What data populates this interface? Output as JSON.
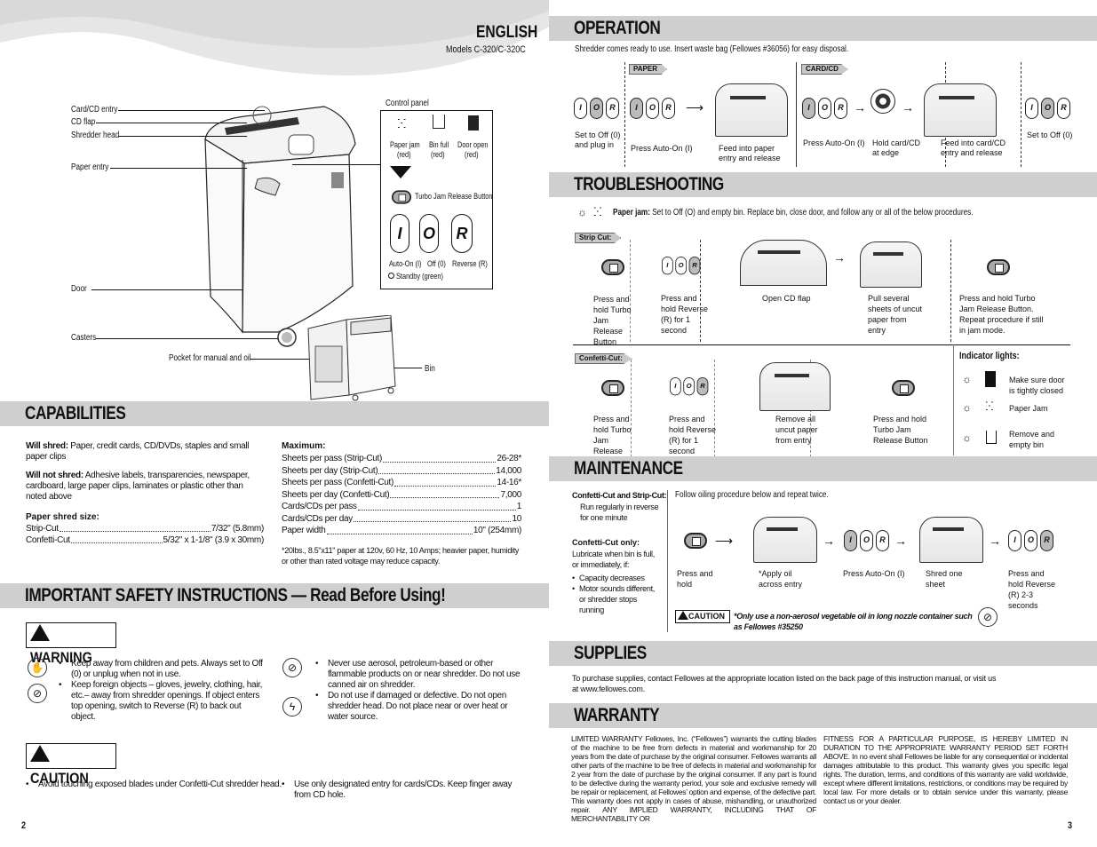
{
  "left_page": {
    "language": "ENGLISH",
    "models": "Models C-320/C-320C",
    "diagram_labels": {
      "card_cd_entry": "Card/CD entry",
      "cd_flap": "CD flap",
      "shredder_head": "Shredder head",
      "paper_entry": "Paper entry",
      "door": "Door",
      "casters": "Casters",
      "pocket": "Pocket for manual and oil",
      "bin": "Bin"
    },
    "control_panel": {
      "title": "Control panel",
      "indicators": [
        {
          "label": "Paper jam",
          "color": "(red)",
          "icon": "paper-jam-icon"
        },
        {
          "label": "Bin full",
          "color": "(red)",
          "icon": "bin-full-icon"
        },
        {
          "label": "Door open",
          "color": "(red)",
          "icon": "door-open-icon"
        }
      ],
      "turbo_label": "Turbo Jam Release Button",
      "buttons": [
        {
          "glyph": "I",
          "label": "Auto-On (I)"
        },
        {
          "glyph": "O",
          "label": "Off (0)"
        },
        {
          "glyph": "R",
          "label": "Reverse (R)"
        }
      ],
      "standby": "Standby (green)"
    },
    "capabilities": {
      "title": "CAPABILITIES",
      "will_shred_label": "Will shred:",
      "will_shred": "Paper, credit cards, CD/DVDs, staples and small paper clips",
      "will_not_shred_label": "Will not shred:",
      "will_not_shred": "Adhesive labels, transparencies, newspaper, cardboard, large paper clips, laminates or plastic other than noted above",
      "shred_size_label": "Paper shred size:",
      "shred_sizes": [
        {
          "name": "Strip-Cut",
          "value": "7/32\" (5.8mm)"
        },
        {
          "name": "Confetti-Cut",
          "value": "5/32\" x 1-1/8\" (3.9 x 30mm)"
        }
      ],
      "maximum_label": "Maximum:",
      "maximums": [
        {
          "name": "Sheets per pass (Strip-Cut)",
          "value": "26-28*"
        },
        {
          "name": "Sheets per day (Strip-Cut)",
          "value": "14,000"
        },
        {
          "name": "Sheets per pass (Confetti-Cut)",
          "value": "14-16*"
        },
        {
          "name": "Sheets per day (Confetti-Cut)",
          "value": "7,000"
        },
        {
          "name": "Cards/CDs per pass",
          "value": "1"
        },
        {
          "name": "Cards/CDs per day",
          "value": "10"
        },
        {
          "name": "Paper width",
          "value": "10\" (254mm)"
        }
      ],
      "footnote": "*20lbs., 8.5\"x11\" paper at 120v, 60 Hz, 10 Amps; heavier paper, humidity or other than rated voltage may reduce capacity."
    },
    "safety": {
      "title": "IMPORTANT SAFETY INSTRUCTIONS — Read Before Using!",
      "warning_label": "WARNING",
      "warnings_left": [
        "Keep away from children and pets. Always set to Off (0) or unplug when not in use.",
        "Keep foreign objects – gloves, jewelry, clothing, hair, etc.–  away from shredder openings. If object enters top opening, switch to Reverse (R) to back out object."
      ],
      "warnings_right": [
        "Never use aerosol, petroleum-based or other flammable products on or near shredder. Do not use canned air on shredder.",
        "Do not use if damaged or defective. Do not open shredder head. Do not place near or over heat or water source."
      ],
      "caution_label": "CAUTION",
      "cautions": [
        "Avoid touching exposed blades under Confetti-Cut shredder head.",
        "Use only designated entry for cards/CDs. Keep finger away from CD hole."
      ]
    },
    "page_number": "2"
  },
  "right_page": {
    "operation": {
      "title": "OPERATION",
      "intro": "Shredder comes ready to use. Insert waste bag (Fellowes #36056) for easy disposal.",
      "paper_tag": "PAPER",
      "card_tag": "CARD/CD",
      "steps": [
        "Set to Off (0) and plug in",
        "Press Auto-On (I)",
        "Feed into paper entry and release",
        "Press Auto-On (I)",
        "Hold card/CD at edge",
        "Feed into card/CD entry and release",
        "Set to Off (0)"
      ]
    },
    "troubleshooting": {
      "title": "TROUBLESHOOTING",
      "paper_jam_label": "Paper jam:",
      "paper_jam_text": "Set to Off (O) and empty bin. Replace bin, close door, and follow any or all of the below procedures.",
      "strip_tag": "Strip Cut:",
      "strip_steps": [
        "Press and hold Turbo Jam Release Button",
        "Press and hold Reverse (R) for 1 second",
        "Open CD flap",
        "Pull several sheets of uncut paper from entry",
        "Press and hold Turbo Jam Release Button. Repeat procedure if still in jam mode."
      ],
      "confetti_tag": "Confetti-Cut:",
      "confetti_steps": [
        "Press and hold Turbo Jam Release Button",
        "Press and hold Reverse (R) for 1 second",
        "Remove all uncut paper from entry",
        "Press and hold Turbo Jam Release Button"
      ],
      "indicator_title": "Indicator lights:",
      "indicators": [
        {
          "icon": "door-icon",
          "text": "Make sure door is tightly closed"
        },
        {
          "icon": "paper-jam-icon",
          "text": "Paper Jam"
        },
        {
          "icon": "bin-icon",
          "text": "Remove and empty bin"
        }
      ]
    },
    "maintenance": {
      "title": "MAINTENANCE",
      "side_title_1": "Confetti-Cut and Strip-Cut:",
      "side_text_1": "Run regularly in reverse for one minute",
      "side_title_2": "Confetti-Cut only:",
      "side_text_2": "Lubricate when bin is full, or immediately, if:",
      "side_bullets": [
        "Capacity decreases",
        "Motor sounds different, or shredder stops running"
      ],
      "intro": "Follow oiling procedure below and repeat twice.",
      "steps": [
        "Press and hold",
        "*Apply oil across entry",
        "Press Auto-On (I)",
        "Shred one sheet",
        "Press and hold Reverse (R) 2-3 seconds"
      ],
      "caution_label": "CAUTION",
      "caution_note": "*Only use a non-aerosol vegetable oil in long nozzle container such as Fellowes #35250"
    },
    "supplies": {
      "title": "SUPPLIES",
      "text": "To purchase supplies, contact Fellowes at the appropriate location listed on the back page of this instruction manual, or visit us at www.fellowes.com."
    },
    "warranty": {
      "title": "WARRANTY",
      "col1": "LIMITED WARRANTY Fellowes, Inc. (“Fellowes”) warrants the cutting blades of the machine to be free from defects in material and workmanship for 20 years from the date of purchase by the original consumer. Fellowes warrants all other parts of the machine to be free of defects in material and workmanship for 2 year from the date of purchase by the original consumer. If any part is found to be defective during the warranty period, your sole and exclusive remedy will be repair or replacement, at Fellowes’ option and expense, of the defective part. This warranty does not apply in cases of abuse, mishandling, or unauthorized repair. ANY IMPLIED WARRANTY, INCLUDING THAT OF MERCHANTABILITY OR",
      "col2": "FITNESS FOR A PARTICULAR PURPOSE, IS HEREBY LIMITED IN DURATION TO THE APPROPRIATE WARRANTY PERIOD SET FORTH ABOVE. In no event shall Fellowes be liable for any consequential or incidental damages attributable to this product. This warranty gives you specific legal rights. The duration, terms, and conditions of this warranty are valid worldwide, except where different limitations, restrictions, or conditions may be required by local law. For more details or to obtain service under this warranty, please contact us or your dealer."
    },
    "page_number": "3"
  }
}
